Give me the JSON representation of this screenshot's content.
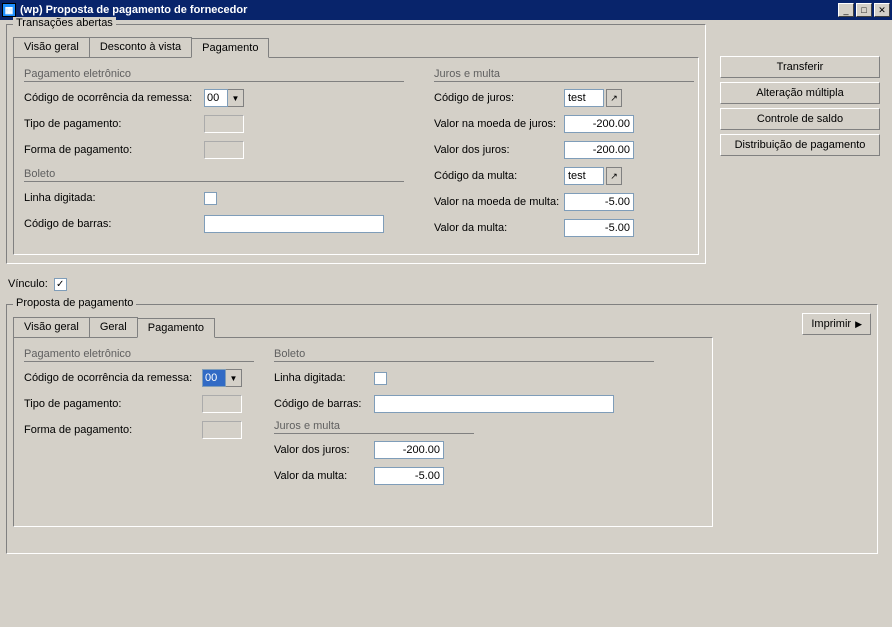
{
  "window": {
    "title": "(wp) Proposta de pagamento de fornecedor"
  },
  "sidebar_buttons": {
    "transfer": "Transferir",
    "multi_change": "Alteração múltipla",
    "balance_control": "Controle de saldo",
    "payment_dist": "Distribuição de pagamento"
  },
  "open_tx": {
    "group_title": "Transações abertas",
    "tabs": {
      "overview": "Visão geral",
      "cash_discount": "Desconto à vista",
      "payment": "Pagamento"
    },
    "sections": {
      "e_payment": "Pagamento eletrônico",
      "boleto": "Boleto",
      "interest_fine": "Juros e multa"
    },
    "labels": {
      "remittance_code": "Código de ocorrência da remessa:",
      "payment_type": "Tipo de pagamento:",
      "payment_form": "Forma de pagamento:",
      "typed_line": "Linha digitada:",
      "barcode": "Código de barras:",
      "interest_code": "Código de juros:",
      "interest_currency_value": "Valor na moeda de juros:",
      "interest_value": "Valor dos juros:",
      "fine_code": "Código da multa:",
      "fine_currency_value": "Valor na moeda de multa:",
      "fine_value": "Valor da multa:"
    },
    "values": {
      "remittance_code": "00",
      "payment_type": "",
      "payment_form": "",
      "typed_line_checked": false,
      "barcode": "",
      "interest_code": "test",
      "interest_currency_value": "-200.00",
      "interest_value": "-200.00",
      "fine_code": "test",
      "fine_currency_value": "-5.00",
      "fine_value": "-5.00"
    }
  },
  "link": {
    "label": "Vínculo:",
    "checked": true
  },
  "proposal": {
    "group_title": "Proposta de pagamento",
    "tabs": {
      "overview": "Visão geral",
      "general": "Geral",
      "payment": "Pagamento"
    },
    "print_btn": "Imprimir",
    "sections": {
      "e_payment": "Pagamento eletrônico",
      "boleto": "Boleto",
      "interest_fine": "Juros e multa"
    },
    "labels": {
      "remittance_code": "Código de ocorrência da remessa:",
      "payment_type": "Tipo de pagamento:",
      "payment_form": "Forma de pagamento:",
      "typed_line": "Linha digitada:",
      "barcode": "Código de barras:",
      "interest_value": "Valor dos juros:",
      "fine_value": "Valor da multa:"
    },
    "values": {
      "remittance_code": "00",
      "payment_type": "",
      "payment_form": "",
      "typed_line_checked": false,
      "barcode": "",
      "interest_value": "-200.00",
      "fine_value": "-5.00"
    }
  }
}
